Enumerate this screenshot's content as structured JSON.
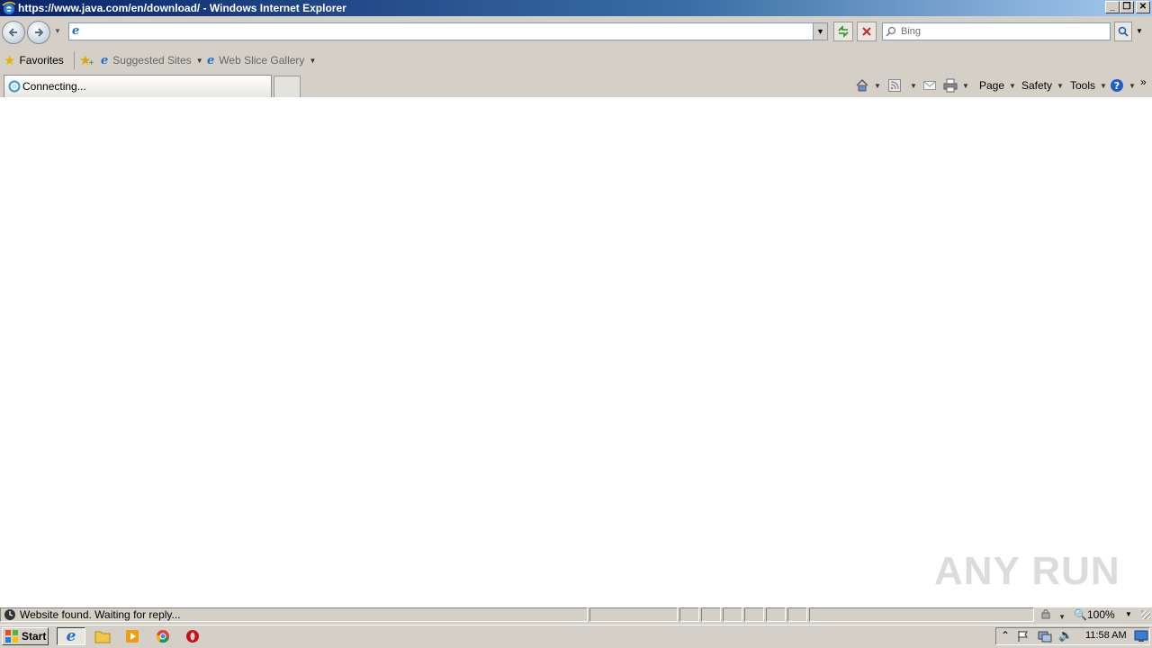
{
  "window": {
    "title": "https://www.java.com/en/download/ - Windows Internet Explorer",
    "min_glyph": "_",
    "max_glyph": "❐",
    "close_glyph": "✕"
  },
  "nav": {
    "address_value": "",
    "search_placeholder": "Bing",
    "dropdown_glyph": "▼"
  },
  "favorites_bar": {
    "favorites_label": "Favorites",
    "suggested_sites_label": "Suggested Sites",
    "web_slice_gallery_label": "Web Slice Gallery"
  },
  "tab": {
    "label": "Connecting..."
  },
  "command_bar": {
    "page_label": "Page",
    "safety_label": "Safety",
    "tools_label": "Tools",
    "more_glyph": "»"
  },
  "watermark": "ANY RUN",
  "status_bar": {
    "text": "Website found. Waiting for reply...",
    "zoom": "100%"
  },
  "taskbar": {
    "start_label": "Start",
    "clock": "11:58 AM"
  },
  "colors": {
    "title_gradient_start": "#0a246a",
    "title_gradient_end": "#a6caf0",
    "chrome": "#d4d0c8",
    "ie_blue": "#1a6fd0"
  }
}
